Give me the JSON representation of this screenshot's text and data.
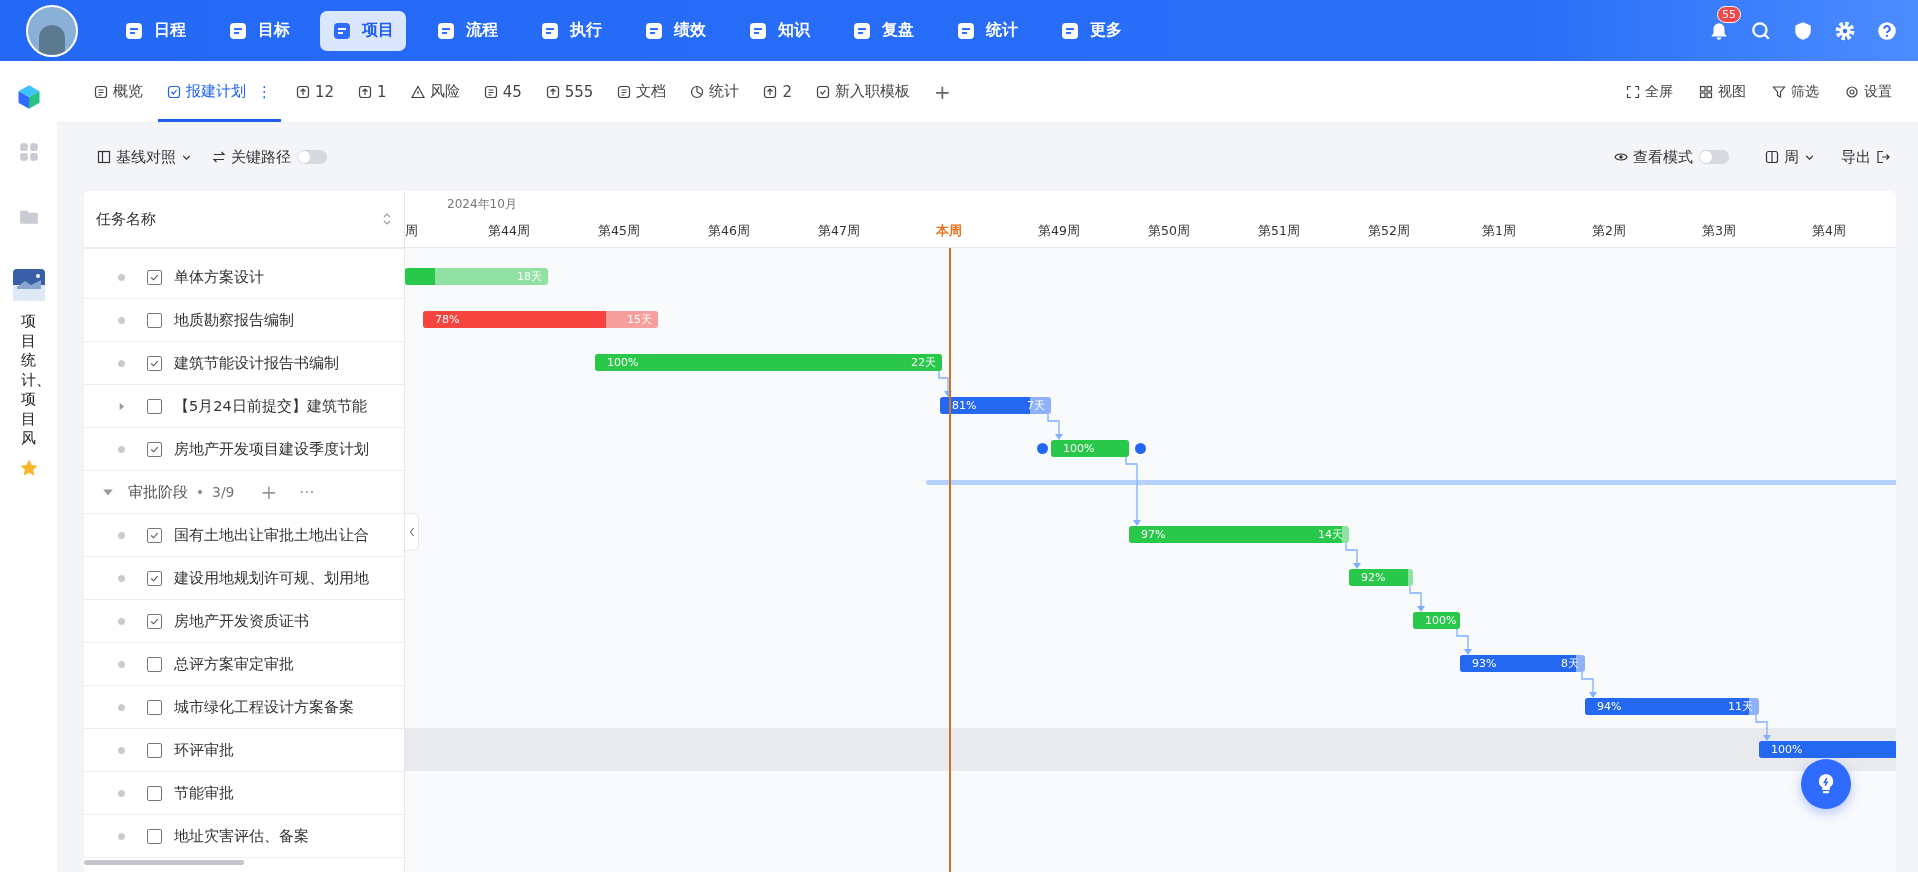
{
  "nav": {
    "items": [
      {
        "label": "日程",
        "selected": false
      },
      {
        "label": "目标",
        "selected": false
      },
      {
        "label": "项目",
        "selected": true
      },
      {
        "label": "流程",
        "selected": false
      },
      {
        "label": "执行",
        "selected": false
      },
      {
        "label": "绩效",
        "selected": false
      },
      {
        "label": "知识",
        "selected": false
      },
      {
        "label": "复盘",
        "selected": false
      },
      {
        "label": "统计",
        "selected": false
      },
      {
        "label": "更多",
        "selected": false
      }
    ],
    "badge": "55"
  },
  "tabs": {
    "items": [
      {
        "label": "概览",
        "selected": false
      },
      {
        "label": "报建计划",
        "selected": true,
        "menu": "⋮"
      },
      {
        "label": "12",
        "selected": false
      },
      {
        "label": "1",
        "selected": false
      },
      {
        "label": "风险",
        "selected": false
      },
      {
        "label": "45",
        "selected": false
      },
      {
        "label": "555",
        "selected": false
      },
      {
        "label": "文档",
        "selected": false
      },
      {
        "label": "统计",
        "selected": false
      },
      {
        "label": "2",
        "selected": false
      },
      {
        "label": "新入职模板",
        "selected": false
      }
    ],
    "add": "+",
    "actions": [
      "全屏",
      "视图",
      "筛选",
      "设置"
    ]
  },
  "sidebar": {
    "project_name": "项目统计、项目风",
    "starred": true
  },
  "toolbar": {
    "baseline": "基线对照",
    "critical_path": {
      "label": "关键路径",
      "on": false
    },
    "view_mode": {
      "label": "查看模式",
      "on": false
    },
    "scale": "周",
    "export": "导出"
  },
  "gantt": {
    "column_header": "任务名称",
    "month": "2024年10月",
    "weeks": [
      {
        "label": "周",
        "current": false
      },
      {
        "label": "第44周",
        "current": false
      },
      {
        "label": "第45周",
        "current": false
      },
      {
        "label": "第46周",
        "current": false
      },
      {
        "label": "第47周",
        "current": false
      },
      {
        "label": "本周",
        "current": true
      },
      {
        "label": "第49周",
        "current": false
      },
      {
        "label": "第50周",
        "current": false
      },
      {
        "label": "第51周",
        "current": false
      },
      {
        "label": "第52周",
        "current": false
      },
      {
        "label": "第1周",
        "current": false
      },
      {
        "label": "第2周",
        "current": false
      },
      {
        "label": "第3周",
        "current": false
      },
      {
        "label": "第4周",
        "current": false
      }
    ],
    "rows": [
      {
        "kind": "task",
        "name": "单体方案设计",
        "checked": true,
        "bar": {
          "color": "#2ac84a",
          "level": 0.21,
          "duration": "18天"
        }
      },
      {
        "kind": "task",
        "name": "地质勘察报告编制",
        "checked": false,
        "bar": {
          "color": "#f5443e",
          "level": 0.78,
          "percent": "78%",
          "duration": "15天"
        }
      },
      {
        "kind": "task",
        "name": "建筑节能设计报告书编制",
        "checked": true,
        "bar": {
          "color": "#2ac84a",
          "level": 1,
          "percent": "100%",
          "duration": "22天"
        }
      },
      {
        "kind": "task",
        "name": "【5月24日前提交】建筑节能",
        "checked": false,
        "expanded": false,
        "bar": {
          "color": "#2468f2",
          "level": 0.81,
          "percent": "81%",
          "duration": "7天"
        }
      },
      {
        "kind": "task",
        "name": "房地产开发项目建设季度计划",
        "checked": true,
        "bar": {
          "color": "#2ac84a",
          "level": 1,
          "percent": "100%",
          "selected": true
        }
      },
      {
        "kind": "group",
        "name": "审批阶段",
        "count": "3/9",
        "expanded": true,
        "add": "+",
        "more": "···"
      },
      {
        "kind": "task",
        "name": "国有土地出让审批土地出让合",
        "checked": true,
        "bar": {
          "color": "#2ac84a",
          "level": 0.97,
          "percent": "97%",
          "duration": "14天"
        }
      },
      {
        "kind": "task",
        "name": "建设用地规划许可规、划用地",
        "checked": true,
        "bar": {
          "color": "#2ac84a",
          "level": 0.92,
          "percent": "92%"
        }
      },
      {
        "kind": "task",
        "name": "房地产开发资质证书",
        "checked": true,
        "bar": {
          "color": "#2ac84a",
          "level": 1,
          "percent": "100%"
        }
      },
      {
        "kind": "task",
        "name": "总评方案审定审批",
        "checked": false,
        "bar": {
          "color": "#2468f2",
          "level": 0.93,
          "percent": "93%",
          "duration": "8天"
        }
      },
      {
        "kind": "task",
        "name": "城市绿化工程设计方案备案",
        "checked": false,
        "bar": {
          "color": "#2468f2",
          "level": 0.94,
          "percent": "94%",
          "duration": "11天"
        }
      },
      {
        "kind": "task",
        "name": "环评审批",
        "checked": false,
        "hovered": true,
        "bar": {
          "color": "#2468f2",
          "level": 1,
          "percent": "100%"
        }
      },
      {
        "kind": "task",
        "name": "节能审批",
        "checked": false
      },
      {
        "kind": "task",
        "name": "地址灾害评估、备案",
        "checked": false
      }
    ]
  }
}
